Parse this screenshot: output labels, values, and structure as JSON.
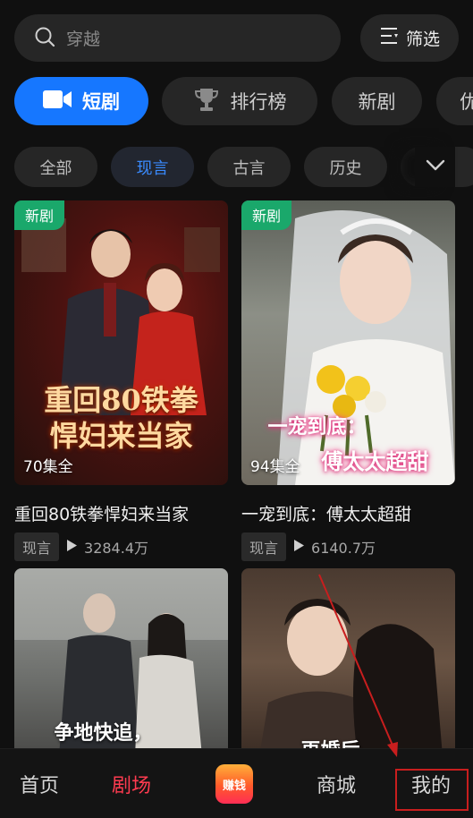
{
  "search": {
    "placeholder": "穿越",
    "filter_label": "筛选"
  },
  "categories": [
    {
      "label": "短剧"
    },
    {
      "label": "排行榜"
    },
    {
      "label": "新剧"
    },
    {
      "label": "优"
    }
  ],
  "subcategories": [
    {
      "label": "全部"
    },
    {
      "label": "现言"
    },
    {
      "label": "古言"
    },
    {
      "label": "历史"
    }
  ],
  "cards": [
    {
      "badge": "新剧",
      "episodes": "70集全",
      "poster_text_1": "重回80铁拳",
      "poster_text_2": "悍妇来当家",
      "title": "重回80铁拳悍妇来当家",
      "tag": "现言",
      "plays": "3284.4万"
    },
    {
      "badge": "新剧",
      "episodes": "94集全",
      "poster_text_1": "一宠到底：",
      "poster_text_2": "傅太太超甜",
      "title": "一宠到底：傅太太超甜",
      "tag": "现言",
      "plays": "6140.7万"
    },
    {
      "poster_text_1": "争地快追，"
    },
    {
      "poster_text_1": "再婚后"
    }
  ],
  "tabbar": {
    "home": "首页",
    "theater": "剧场",
    "earn": "赚钱",
    "mall": "商城",
    "mine": "我的"
  },
  "colors": {
    "accent_blue": "#1677ff",
    "active_red": "#ff3b50",
    "new_badge_green": "#1aa86b",
    "highlight_red": "#c81e1e"
  }
}
